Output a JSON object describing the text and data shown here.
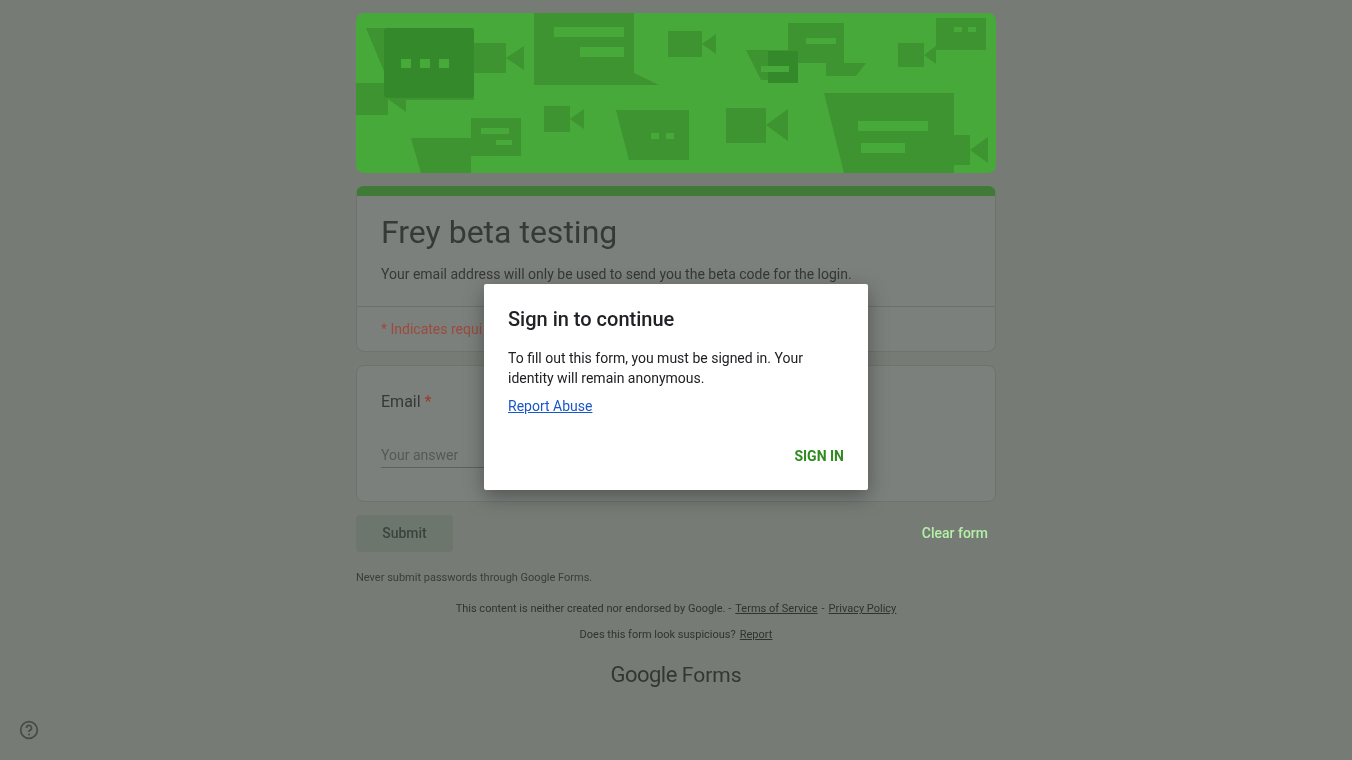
{
  "form": {
    "title": "Frey beta testing",
    "description": "Your email address will only be used to send you the beta code for the login.",
    "required_note": "* Indicates requi",
    "questions": [
      {
        "label": "Email",
        "required_mark": "*",
        "placeholder": "Your answer"
      }
    ],
    "submit": {
      "label": "Submit",
      "disabled": true
    },
    "clear": "Clear form"
  },
  "footer": {
    "warning": "Never submit passwords through Google Forms.",
    "disclaimer": "This content is neither created nor endorsed by Google. -",
    "links": [
      "Terms of Service",
      "Privacy Policy"
    ],
    "separator": "-",
    "suspicious": "Does this form look suspicious?",
    "report": "Report",
    "logo": {
      "brand": "Google",
      "product": "Forms"
    }
  },
  "dialog": {
    "title": "Sign in to continue",
    "body": "To fill out this form, you must be signed in. Your identity will remain anonymous.",
    "link": "Report Abuse",
    "button": "SIGN IN"
  }
}
